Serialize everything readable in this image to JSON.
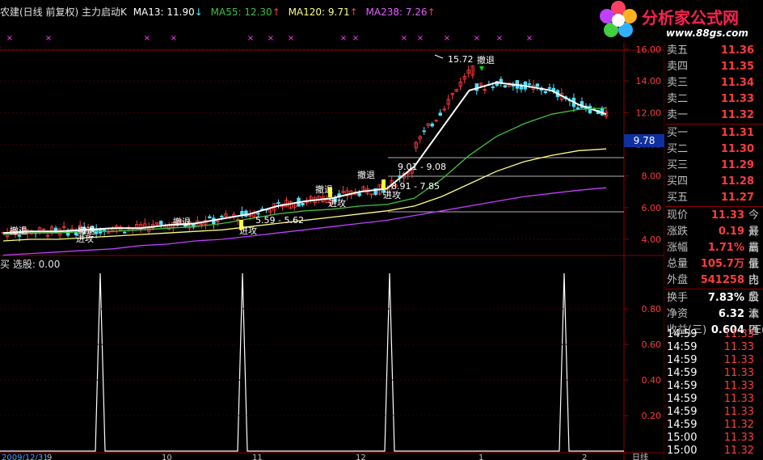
{
  "header": {
    "stock_title": "农建(日线 前复权) 主力启动K",
    "ma13_label": "MA13: 11.90",
    "ma13_arrow": "↓",
    "ma55_label": "MA55: 12.30",
    "ma55_arrow": "↑",
    "ma120_label": "MA120: 9.71",
    "ma120_arrow": "↑",
    "ma238_label": "MA238: 7.26",
    "ma238_arrow": "↑",
    "site_title": "分析家公式网",
    "site_url": "www.88gs.com"
  },
  "lower_panel": {
    "title": "买 选股: 0.00"
  },
  "colors": {
    "bg": "#000000",
    "up": "#ff3c3c",
    "down": "#50e0ff",
    "ma13": "#ffffff",
    "ma55": "#40c040",
    "ma120": "#ffff80",
    "ma238": "#c040ff",
    "grid": "#8b0000"
  },
  "chart_data": [
    {
      "type": "line",
      "name": "price",
      "yticks": [
        "16.00",
        "14.00",
        "12.00",
        "10.00",
        "8.00",
        "6.00",
        "4.00"
      ],
      "ylim": [
        3.0,
        16.5
      ],
      "current_price_label": "9.78",
      "annotations": [
        {
          "text": "15.72"
        },
        {
          "text": "撤退"
        },
        {
          "text": "撤退"
        },
        {
          "text": "撤退"
        },
        {
          "text": "撤退"
        },
        {
          "text": "撤退"
        },
        {
          "text": "撤退"
        },
        {
          "text": "进攻"
        },
        {
          "text": "进攻"
        },
        {
          "text": "进攻"
        },
        {
          "text": "进攻"
        },
        {
          "text": "9.01 - 9.08"
        },
        {
          "text": "8.91 - 7.85"
        },
        {
          "text": "5.59 - 5.62"
        }
      ],
      "x_labels": [
        "2009/12/31",
        "9",
        "10",
        "11",
        "12",
        "1",
        "2",
        "日线"
      ],
      "series": [
        {
          "name": "MA13",
          "values": [
            4.4,
            4.5,
            4.5,
            4.6,
            4.7,
            4.7,
            4.9,
            5.0,
            5.3,
            5.6,
            6.1,
            6.4,
            6.6,
            7.0,
            7.2,
            8.6,
            11.0,
            13.4,
            13.9,
            13.7,
            13.4,
            12.5,
            11.9
          ]
        },
        {
          "name": "MA55",
          "values": [
            4.3,
            4.4,
            4.4,
            4.5,
            4.5,
            4.6,
            4.7,
            4.8,
            5.0,
            5.3,
            5.6,
            5.8,
            5.9,
            6.1,
            6.2,
            6.6,
            7.8,
            9.3,
            10.5,
            11.3,
            11.9,
            12.2,
            12.3
          ]
        },
        {
          "name": "MA120",
          "values": [
            3.9,
            4.0,
            4.0,
            4.1,
            4.2,
            4.3,
            4.4,
            4.5,
            4.6,
            4.8,
            5.0,
            5.2,
            5.4,
            5.6,
            5.8,
            6.1,
            6.7,
            7.5,
            8.3,
            8.9,
            9.3,
            9.6,
            9.71
          ]
        },
        {
          "name": "MA238",
          "values": [
            3.0,
            3.1,
            3.2,
            3.3,
            3.4,
            3.6,
            3.7,
            3.9,
            4.0,
            4.2,
            4.4,
            4.6,
            4.8,
            5.0,
            5.2,
            5.5,
            5.8,
            6.1,
            6.4,
            6.7,
            6.9,
            7.1,
            7.26
          ]
        }
      ]
    },
    {
      "type": "line",
      "name": "选股",
      "yticks": [
        "0.80",
        "0.60",
        "0.40",
        "0.20"
      ],
      "ylim": [
        0,
        1
      ],
      "series": [
        {
          "name": "选股",
          "values": [
            0,
            0,
            1,
            0,
            0,
            0,
            1,
            0,
            0,
            0,
            1,
            0,
            0,
            0,
            1,
            0
          ]
        }
      ]
    }
  ],
  "quote": {
    "asks": [
      {
        "label": "卖五",
        "price": "11.36"
      },
      {
        "label": "卖四",
        "price": "11.35"
      },
      {
        "label": "卖三",
        "price": "11.34"
      },
      {
        "label": "卖二",
        "price": "11.33"
      },
      {
        "label": "卖一",
        "price": "11.32"
      }
    ],
    "bids": [
      {
        "label": "买一",
        "price": "11.31"
      },
      {
        "label": "买二",
        "price": "11.30"
      },
      {
        "label": "买三",
        "price": "11.29"
      },
      {
        "label": "买四",
        "price": "11.28"
      },
      {
        "label": "买五",
        "price": "11.27"
      }
    ],
    "stats": [
      {
        "label": "现价",
        "value": "11.33",
        "ext": "今开"
      },
      {
        "label": "涨跌",
        "value": "0.19",
        "ext": "最高"
      },
      {
        "label": "涨幅",
        "value": "1.71%",
        "ext": "最低"
      },
      {
        "label": "总量",
        "value": "105.7万",
        "ext": "量比"
      },
      {
        "label": "外盘",
        "value": "541258",
        "ext": "内盘"
      },
      {
        "label": "换手",
        "value": "7.83%",
        "ext": "股本"
      },
      {
        "label": "净资",
        "value": "6.32",
        "ext": "流通"
      },
      {
        "label": "收益(三)",
        "value": "0.604",
        "ext": "PE("
      }
    ]
  },
  "ticks": [
    {
      "time": "14:59",
      "price": "11.33"
    },
    {
      "time": "14:59",
      "price": "11.33"
    },
    {
      "time": "14:59",
      "price": "11.33"
    },
    {
      "time": "14:59",
      "price": "11.33"
    },
    {
      "time": "14:59",
      "price": "11.33"
    },
    {
      "time": "14:59",
      "price": "11.33"
    },
    {
      "time": "14:59",
      "price": "11.33"
    },
    {
      "time": "14:59",
      "price": "11.32"
    },
    {
      "time": "15:00",
      "price": "11.33"
    },
    {
      "time": "15:00",
      "price": "11.32"
    }
  ]
}
